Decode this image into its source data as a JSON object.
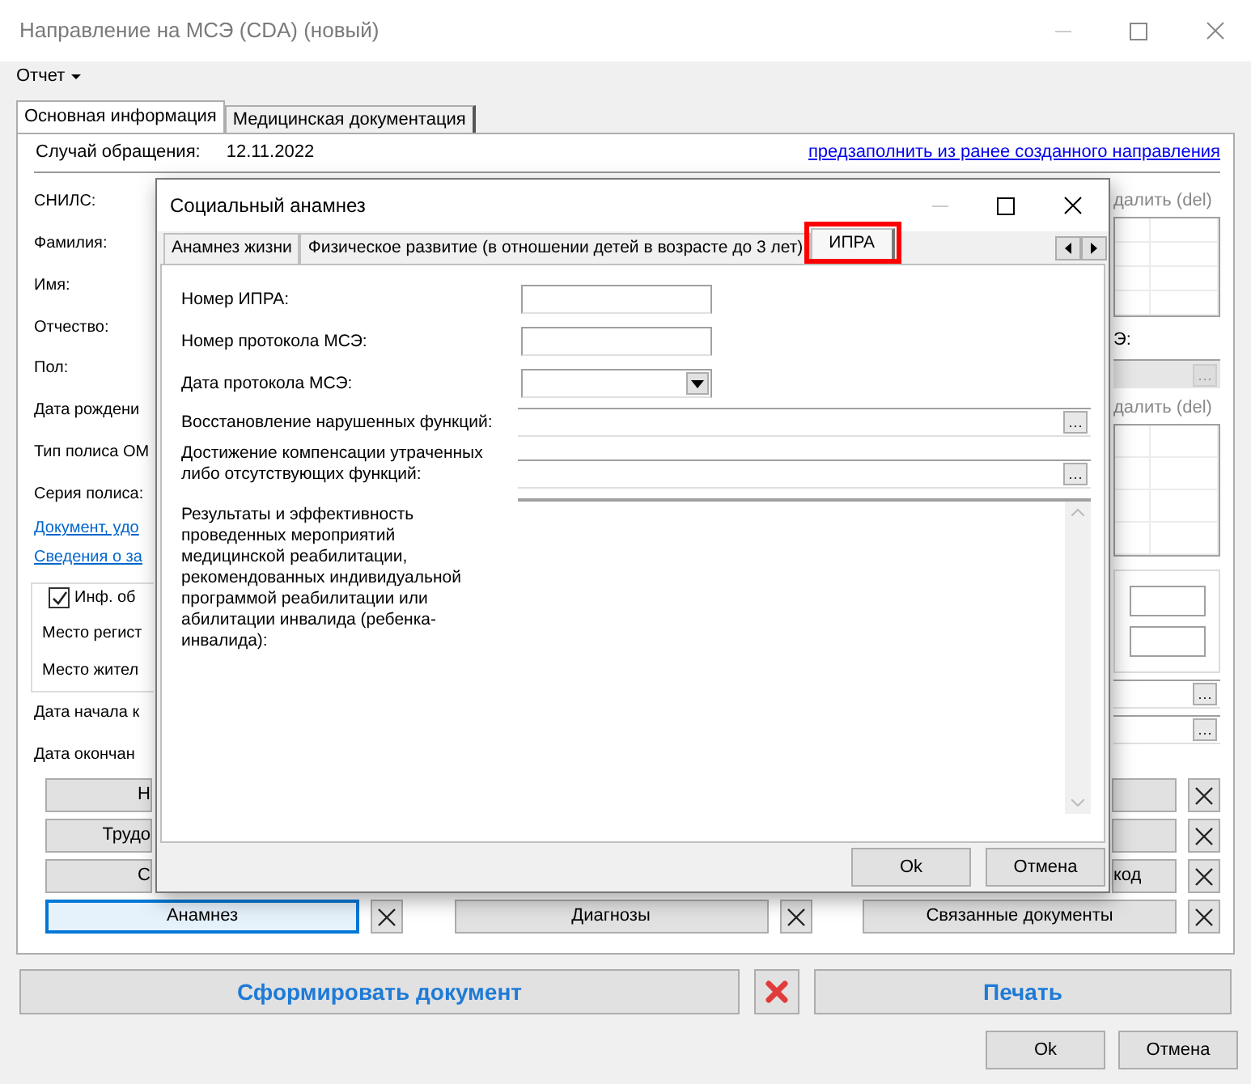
{
  "window": {
    "title": "Направление на МСЭ (CDA) (новый)"
  },
  "menu": [
    {
      "label": "Отчет"
    }
  ],
  "tabs": [
    {
      "label": "Основная информация",
      "selected": true
    },
    {
      "label": "Медицинская документация",
      "selected": false
    }
  ],
  "case": {
    "label": "Случай обращения:",
    "value": "12.11.2022",
    "link": "предзаполнить из ранее созданного направления"
  },
  "left_column": [
    {
      "kind": "label",
      "text": "СНИЛС:"
    },
    {
      "kind": "label",
      "text": "Фамилия:"
    },
    {
      "kind": "label",
      "text": "Имя:"
    },
    {
      "kind": "label",
      "text": "Отчество:"
    },
    {
      "kind": "label",
      "text": "Пол:"
    },
    {
      "kind": "label",
      "text": "Дата рождени"
    },
    {
      "kind": "label",
      "text": "Тип полиса ОМ"
    },
    {
      "kind": "label",
      "text": "Серия полиса:"
    },
    {
      "kind": "link",
      "text": "Документ, удо"
    },
    {
      "kind": "link",
      "text": "Сведения о за"
    },
    {
      "kind": "group",
      "checkbox": {
        "label": "Инф. об",
        "checked": true
      },
      "labels": [
        "Место регист",
        "Место жител"
      ]
    },
    {
      "kind": "label",
      "text": "Дата начала к"
    },
    {
      "kind": "label",
      "text": "Дата окончан"
    }
  ],
  "right_column": [
    {
      "kind": "disabled_link",
      "text": "далить (del)"
    },
    {
      "kind": "grid"
    },
    {
      "kind": "label",
      "text": "Э:"
    },
    {
      "kind": "lookup",
      "disabled": true
    },
    {
      "kind": "disabled_link",
      "text": "далить (del)"
    },
    {
      "kind": "grid"
    },
    {
      "kind": "inputs"
    },
    {
      "kind": "lookup"
    },
    {
      "kind": "lookup"
    }
  ],
  "button_rows": [
    {
      "left": "Н",
      "right": ""
    },
    {
      "left": "Трудо",
      "right": ""
    },
    {
      "left": "С",
      "right": "код"
    }
  ],
  "bottom_buttons": [
    {
      "label": "Анамнез",
      "focused": true
    },
    {
      "label": "Диагнозы",
      "focused": false
    },
    {
      "label": "Связанные документы",
      "focused": false
    }
  ],
  "actions": {
    "generate": "Сформировать документ",
    "print": "Печать"
  },
  "footer_buttons": [
    "Ok",
    "Отмена"
  ],
  "dialog": {
    "title": "Социальный анамнез",
    "tabs": [
      {
        "label": "Анамнез жизни",
        "selected": false
      },
      {
        "label": "Физическое развитие (в отношении детей в возрасте до 3 лет)",
        "selected": false
      },
      {
        "label": "ИПРА",
        "selected": true,
        "highlighted": true
      }
    ],
    "fields": [
      {
        "kind": "text",
        "label": "Номер ИПРА:"
      },
      {
        "kind": "text",
        "label": "Номер протокола МСЭ:"
      },
      {
        "kind": "date",
        "label": "Дата протокола МСЭ:"
      },
      {
        "kind": "lookup",
        "label": "Восстановление нарушенных функций:"
      },
      {
        "kind": "lookup",
        "label": "Достижение компенсации утраченных либо отсутствующих функций:"
      },
      {
        "kind": "textarea",
        "label": "Результаты и эффективность проведенных мероприятий медицинской реабилитации, рекомендованных индивидуальной программой реабилитации или абилитации инвалида (ребенка-инвалида):"
      }
    ],
    "buttons": [
      "Ok",
      "Отмена"
    ]
  }
}
